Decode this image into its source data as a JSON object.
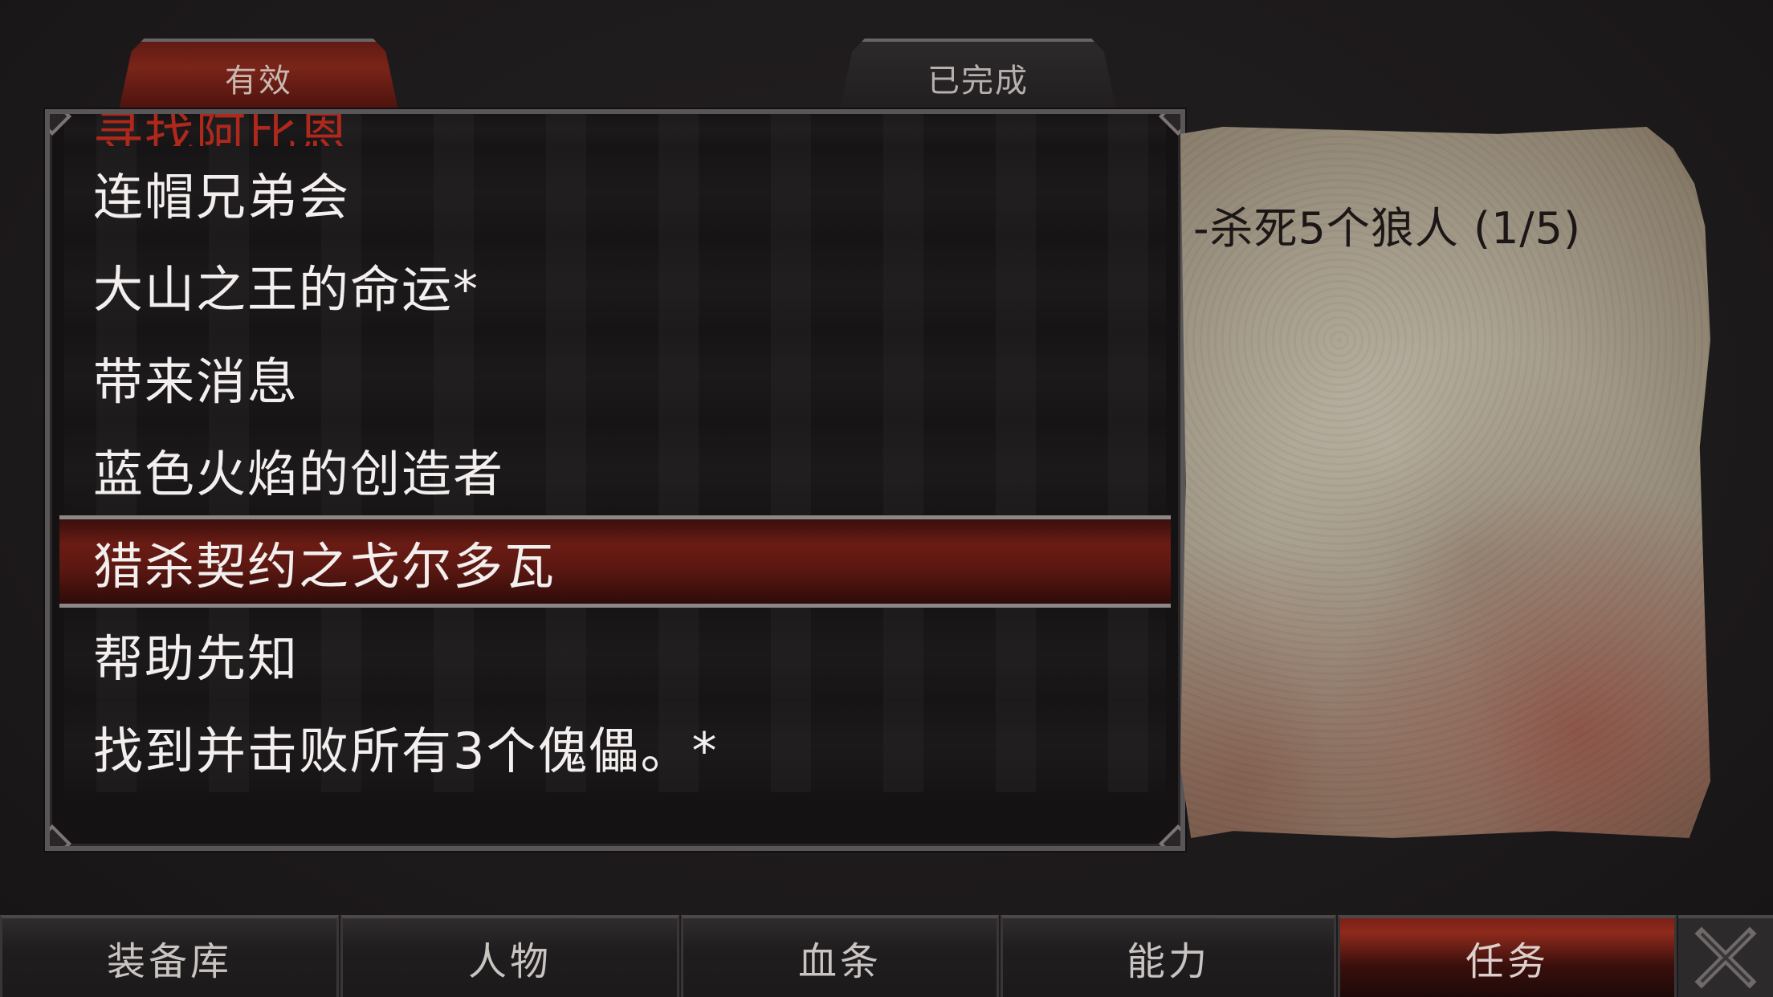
{
  "tabs": {
    "active": "有效",
    "completed": "已完成"
  },
  "quests": [
    {
      "title": "寻找阿比恩",
      "state": "partial"
    },
    {
      "title": "连帽兄弟会",
      "state": "normal"
    },
    {
      "title": "大山之王的命运*",
      "state": "normal"
    },
    {
      "title": "带来消息",
      "state": "normal"
    },
    {
      "title": "蓝色火焰的创造者",
      "state": "normal"
    },
    {
      "title": "猎杀契约之戈尔多瓦",
      "state": "selected"
    },
    {
      "title": "帮助先知",
      "state": "normal"
    },
    {
      "title": "找到并击败所有3个傀儡。*",
      "state": "normal"
    }
  ],
  "detail": {
    "objective": "-杀死5个狼人 (1/5)"
  },
  "nav": {
    "inventory": "装备库",
    "character": "人物",
    "health": "血条",
    "abilities": "能力",
    "quests": "任务",
    "close_icon": "close-x-icon"
  },
  "colors": {
    "accent_red": "#8e2a1c",
    "partial_quest_red": "#b0281c",
    "text_light": "#f2efee"
  }
}
